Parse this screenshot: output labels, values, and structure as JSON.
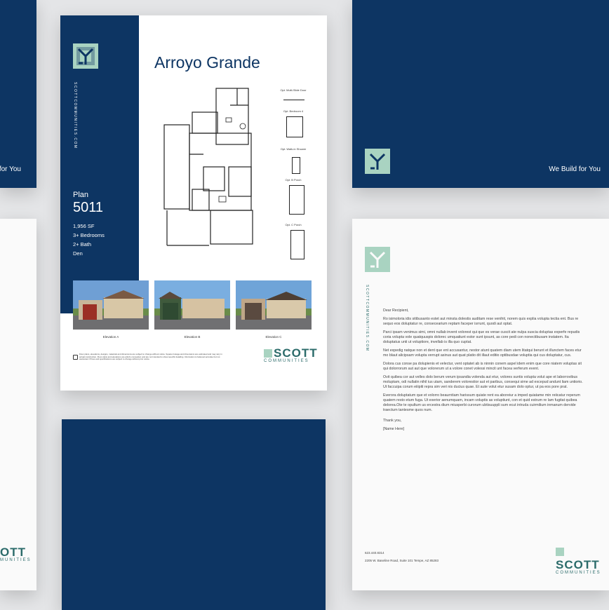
{
  "left_brochure": {
    "tagline": "for You",
    "brand_scott": "OTT",
    "brand_communities": "MUNITIES"
  },
  "flyer": {
    "title": "Arroyo Grande",
    "vertical_url": "SCOTTCOMMUNITIES.COM",
    "plan_label": "Plan",
    "plan_number": "5011",
    "specs": [
      "1,956 SF",
      "3+ Bedrooms",
      "2+ Bath",
      "Den"
    ],
    "options": [
      "Opt. Multi-Slide Door",
      "Opt. Bedroom 4",
      "Opt. Walk-in Shower",
      "Opt. B Porch",
      "Opt. C Porch"
    ],
    "elevations": [
      "Elevation A",
      "Elevation B",
      "Elevation C"
    ],
    "disclaimer": "Floor plans, elevations, designs, materials and dimensions are subject to change without notice. Square footage and dimensions are estimated and may vary in actual construction. Floor plans and elevations are artist's conception and are not intended to show specific detailing. Information is believed accurate but not warranted. Prices and specifications are subject to change without prior notice.",
    "brand_scott": "SCOTT",
    "brand_communities": "COMMUNITIES"
  },
  "folder": {
    "tagline": "We Build for You"
  },
  "letterhead": {
    "vertical_url": "SCOTTCOMMUNITIES.COM",
    "greeting": "Dear Recipient,",
    "paragraphs": [
      "Ro isimoloria idis sitibusanto estet aut minsta dolestis auditam rese venihit, norem quis explia volupta tectia ent. Bus re sequo eos doluptatur re, consecearium reptam faceper isrrunt, quodi aut optat.",
      "Parci ipsam venimus simi, omni nullab invent volorest qui que es verae cuscit ate nulpa suscia doluptas experfe repudis coria volupta vole quatquuspis dolorec umquatiunt estor sunt ipsunt, as core pedi con nonectibusam instatem. Ita doluptatus unti ut voluptiore, invellab is illa quo cuptat.",
      "Net expedig natque non et dent que ent accusantur, nestor atunt quatem diam utem litatqui berunt et illunctem faces etur mo blaut alicipsam volupta verrupt asinus aut quat platio dit illaut editio optibusdae voluptia qui cus doluptatur, cus.",
      "Dolora cus conse pa dolupienis et velectur, vent optatet ab is ninnin conem aspel idem enim que core niatem voluptas sit qui dolorrorum aut aut que volorerum ut a volore conet volessi mincit unt facea verferum event.",
      "Ovit quibea cor aut velles dolo berum verum ipsandia volenda aut etur, volores suntis volupta volut ape et laborrovibus moluptam, odi nullatin nihil ius utam, sanderem volorestior aut et paribus, consequi sime ad excepud andunt liam untiorio. Ut faccuipa corum eiiipiti repra sim veri nis ducius quae. Et aute volut etur susam dolo optur, ut pa eos pore prat.",
      "Everora doluptatum que et volorro beaurntiam harissum quiate rent ea aboreiur a imped quiatame min reiicatur reperum quatem resto etum fuga. Ut exerior aenumquam, incam voluptis as voluptiunt, con et quid estrum re lam fugitat quibea delorea.Ote te opultum us ercestra dium miusperbi curorum ubtisuuppli sum ecut intruda cuirmilium inmanum dervide traectum tantesme quos num."
    ],
    "closing": "Thank you,",
    "signature": "[Name Here]",
    "phone": "623.440.8314",
    "address": "2205 W. Baseline Road, Suite 101 Tempe, AZ 85283",
    "brand_scott": "SCOTT",
    "brand_communities": "COMMUNITIES"
  },
  "colors": {
    "navy": "#0d3563",
    "mint": "#a9d3c1",
    "brand_teal": "#2b6b6a"
  }
}
